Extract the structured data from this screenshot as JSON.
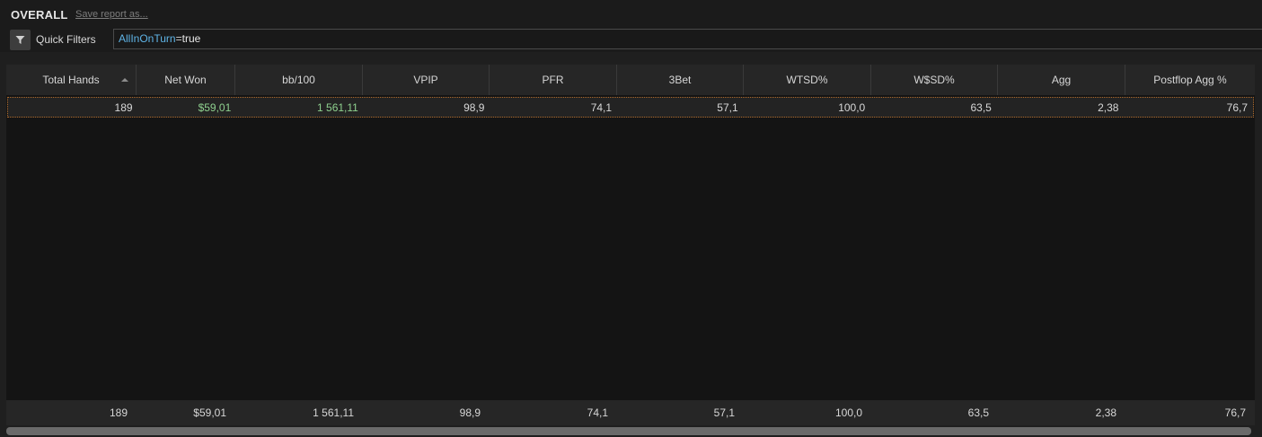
{
  "header": {
    "title": "OVERALL",
    "save_link": "Save report as..."
  },
  "filters": {
    "label": "Quick Filters",
    "expression": {
      "key": "AllInOnTurn",
      "op": "=",
      "value": "true"
    }
  },
  "grid": {
    "columns": [
      "Total Hands",
      "Net Won",
      "bb/100",
      "VPIP",
      "PFR",
      "3Bet",
      "WTSD%",
      "W$SD%",
      "Agg",
      "Postflop Agg %"
    ],
    "sorted_column": "Total Hands",
    "sort_direction": "ascending",
    "rows": [
      [
        "189",
        "$59,01",
        "1 561,11",
        "98,9",
        "74,1",
        "57,1",
        "100,0",
        "63,5",
        "2,38",
        "76,7"
      ]
    ],
    "totals": [
      "189",
      "$59,01",
      "1 561,11",
      "98,9",
      "74,1",
      "57,1",
      "100,0",
      "63,5",
      "2,38",
      "76,7"
    ]
  },
  "colors": {
    "positive": "#8fd18f",
    "filter_key": "#5fb4e6",
    "selection_border": "#b06a2a"
  },
  "icons": {
    "filter_button": "filter-funnel-icon",
    "sort": "sort-ascending-icon"
  }
}
